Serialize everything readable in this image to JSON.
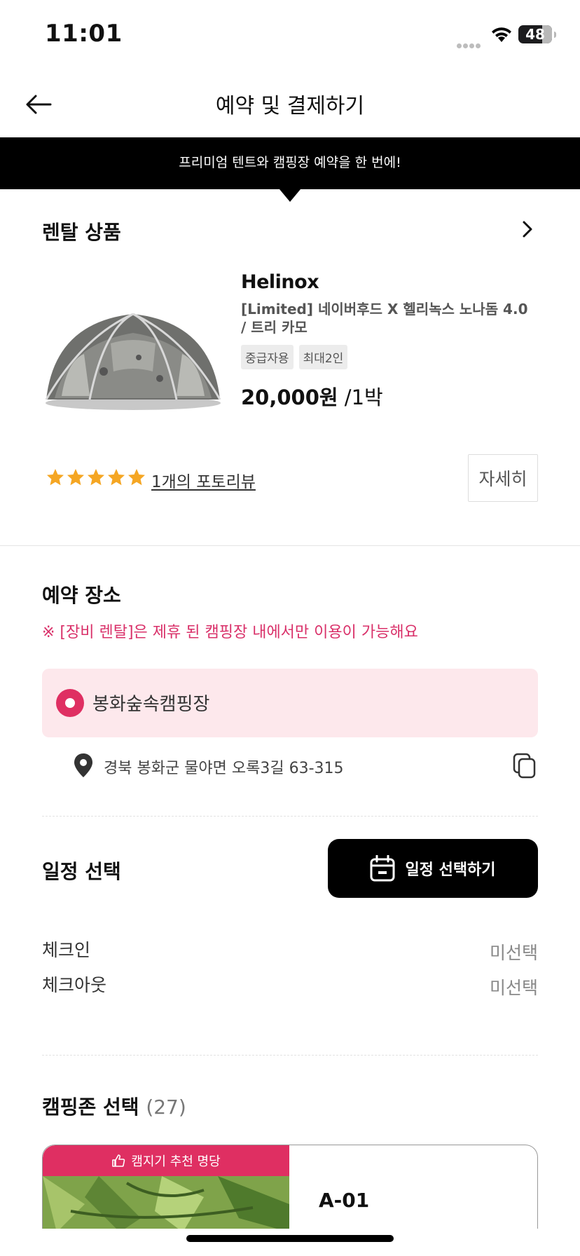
{
  "status_bar": {
    "time": "11:01",
    "battery": "48"
  },
  "nav": {
    "title": "예약 및 결제하기"
  },
  "banner": {
    "text": "프리미엄 텐트와 캠핑장 예약을 한 번에!"
  },
  "rental": {
    "section_title": "렌탈 상품",
    "brand": "Helinox",
    "product_name": "[Limited] 네이버후드 X 헬리녹스 노나돔 4.0 / 트리 카모",
    "tags": [
      "중급자용",
      "최대2인"
    ],
    "price": "20,000원",
    "price_unit": " /1박",
    "rating": 5,
    "review_link": "1개의 포토리뷰",
    "detail_button": "자세히"
  },
  "place": {
    "section_title": "예약 장소",
    "notice": "※ [장비 렌탈]은 제휴 된 캠핑장 내에서만 이용이 가능해요",
    "selected_name": "봉화숲속캠핑장",
    "address": "경북 봉화군 물야면 오록3길 63-315"
  },
  "schedule": {
    "section_title": "일정 선택",
    "button_label": "일정 선택하기",
    "checkin_label": "체크인",
    "checkin_value": "미선택",
    "checkout_label": "체크아웃",
    "checkout_value": "미선택"
  },
  "zone": {
    "section_title": "캠핑존 선택",
    "count": "(27)",
    "badge": "캠지기 추천 명당",
    "first_zone_name": "A-01"
  },
  "colors": {
    "accent": "#df2f62",
    "notice": "#d93069",
    "card_bg": "#fde8ec",
    "star": "#f5a623"
  }
}
